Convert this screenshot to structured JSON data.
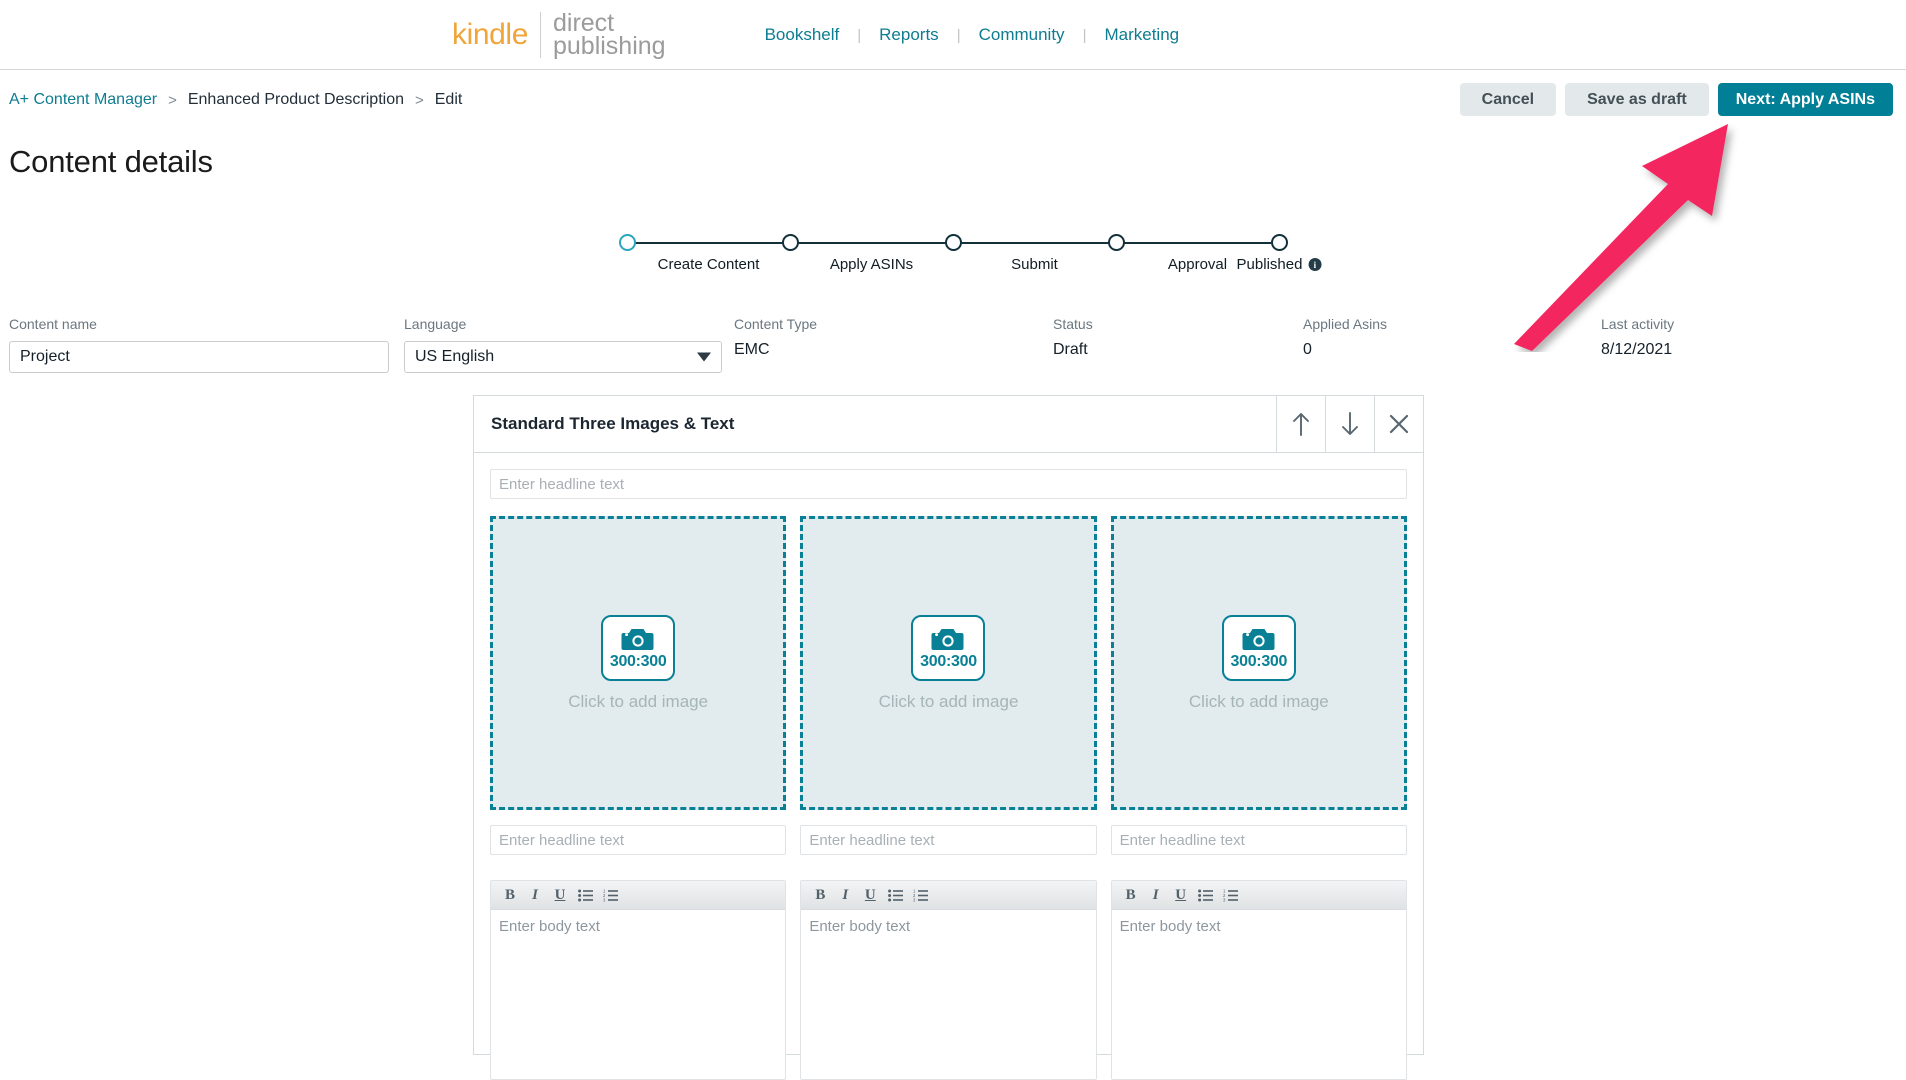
{
  "header": {
    "brand": {
      "kindle": "kindle",
      "direct": "direct",
      "publishing": "publishing"
    },
    "nav": [
      {
        "label": "Bookshelf"
      },
      {
        "label": "Reports"
      },
      {
        "label": "Community"
      },
      {
        "label": "Marketing"
      }
    ],
    "nav_divider": "|"
  },
  "breadcrumb": {
    "root": "A+ Content Manager",
    "mid": "Enhanced Product Description",
    "current": "Edit",
    "separator": ">"
  },
  "toolbar": {
    "cancel_label": "Cancel",
    "save_draft_label": "Save as draft",
    "next_label": "Next: Apply ASINs"
  },
  "page": {
    "title": "Content details"
  },
  "stepper": {
    "steps": [
      {
        "label": "Create Content",
        "state": "active"
      },
      {
        "label": "Apply ASINs",
        "state": "pending"
      },
      {
        "label": "Submit",
        "state": "pending"
      },
      {
        "label": "Approval",
        "state": "pending"
      },
      {
        "label": "Published",
        "state": "pending",
        "info": "i"
      }
    ]
  },
  "meta": {
    "content_name": {
      "label": "Content name",
      "value": "Project"
    },
    "language": {
      "label": "Language",
      "value": "US English"
    },
    "content_type": {
      "label": "Content Type",
      "value": "EMC"
    },
    "status": {
      "label": "Status",
      "value": "Draft"
    },
    "applied_asins": {
      "label": "Applied Asins",
      "value": "0"
    },
    "last_activity": {
      "label": "Last activity",
      "value": "8/12/2021"
    }
  },
  "module": {
    "title": "Standard Three Images & Text",
    "move_up_icon": "arrow-up-icon",
    "move_down_icon": "arrow-down-icon",
    "remove_icon": "close-icon",
    "main_headline_placeholder": "Enter headline text",
    "columns": [
      {
        "image_dimensions": "300:300",
        "image_cta": "Click to add image",
        "headline_placeholder": "Enter headline text",
        "body_placeholder": "Enter body text"
      },
      {
        "image_dimensions": "300:300",
        "image_cta": "Click to add image",
        "headline_placeholder": "Enter headline text",
        "body_placeholder": "Enter body text"
      },
      {
        "image_dimensions": "300:300",
        "image_cta": "Click to add image",
        "headline_placeholder": "Enter headline text",
        "body_placeholder": "Enter body text"
      }
    ],
    "editor_tools": [
      {
        "name": "bold",
        "glyph": "B"
      },
      {
        "name": "italic",
        "glyph": "I"
      },
      {
        "name": "underline",
        "glyph": "U"
      },
      {
        "name": "bulleted-list",
        "glyph": ""
      },
      {
        "name": "numbered-list",
        "glyph": ""
      }
    ]
  },
  "annotation": {
    "arrow_color": "#F3255E",
    "points_to": "Next: Apply ASINs"
  },
  "colors": {
    "brand_orange": "#F0A43A",
    "teal_link": "#0e7c91",
    "primary_button": "#007f96",
    "stepper_active": "#2ba6be",
    "stepper_line": "#12313a",
    "drop_border": "#0a8096",
    "drop_fill": "#e2ebed"
  }
}
